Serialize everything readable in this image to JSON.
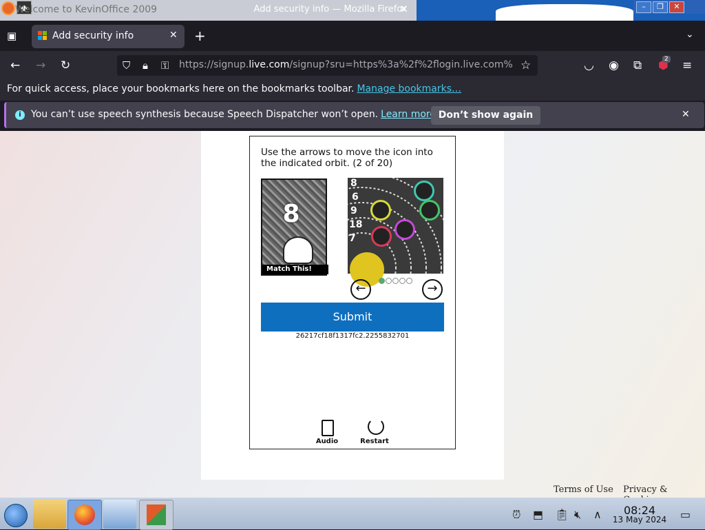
{
  "os_titlebar": {
    "background_window_title": "Welcome to KevinOffice 2009",
    "firefox_window_title": "Add security info — Mozilla Firefox",
    "close_glyph": "✕"
  },
  "browser": {
    "tab": {
      "label": "Add security info",
      "close": "✕"
    },
    "new_tab": "+",
    "url": {
      "prefix": "https://signup.",
      "domain": "live.com",
      "rest": "/signup?sru=https%3a%2f%2flogin.live.com%"
    },
    "extensions_badge": "2",
    "bookmarks_bar": {
      "text": "For quick access, place your bookmarks here on the bookmarks toolbar.",
      "link": "Manage bookmarks…"
    },
    "notification": {
      "text": "You can’t use speech synthesis because Speech Dispatcher won’t open.",
      "link": "Learn more",
      "button": "Don’t show again",
      "close": "✕"
    }
  },
  "captcha": {
    "instruction": "Use the arrows to move the icon into the indicated orbit. (2 of 20)",
    "target_number": "8",
    "target_label": "Match This!",
    "orbit_numbers": [
      "8",
      "6",
      "9",
      "18",
      "7"
    ],
    "submit": "Submit",
    "challenge_id": "26217cf18f1317fc2.2255832701",
    "audio_label": "Audio",
    "restart_label": "Restart",
    "progress_dots": 5,
    "progress_active": 1
  },
  "footer": {
    "terms": "Terms of Use",
    "privacy": "Privacy & Cookies"
  },
  "taskbar": {
    "time": "08:24",
    "date": "13 May 2024"
  },
  "colors": {
    "submit": "#0e6fbf",
    "link": "#45c6e8",
    "accent": "#b86ef0"
  }
}
